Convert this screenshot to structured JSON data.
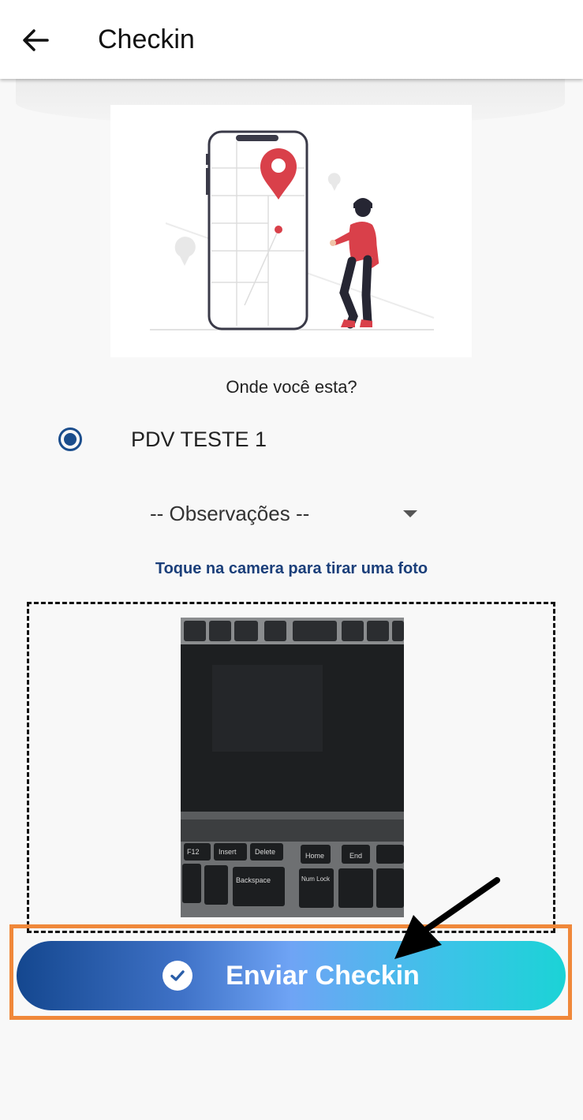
{
  "header": {
    "title": "Checkin",
    "back_icon": "arrow-left-icon"
  },
  "location_prompt": "Onde você esta?",
  "locations": [
    {
      "label": "PDV TESTE 1",
      "selected": true
    }
  ],
  "observations_select": {
    "value": "-- Observações --"
  },
  "camera_hint": "Toque na camera para tirar uma foto",
  "submit": {
    "label": "Enviar Checkin",
    "icon": "check-circle-icon"
  },
  "keyboard_keys": [
    "F12",
    "Insert",
    "Delete",
    "Home",
    "End",
    "Backspace",
    "Num Lock"
  ],
  "colors": {
    "primary": "#1b4d8c",
    "hint_text": "#1b3f7a",
    "pin_red": "#d9404a",
    "gradient_start": "#14478f",
    "gradient_end": "#1bd3d6",
    "highlight_border": "#f0883a"
  }
}
